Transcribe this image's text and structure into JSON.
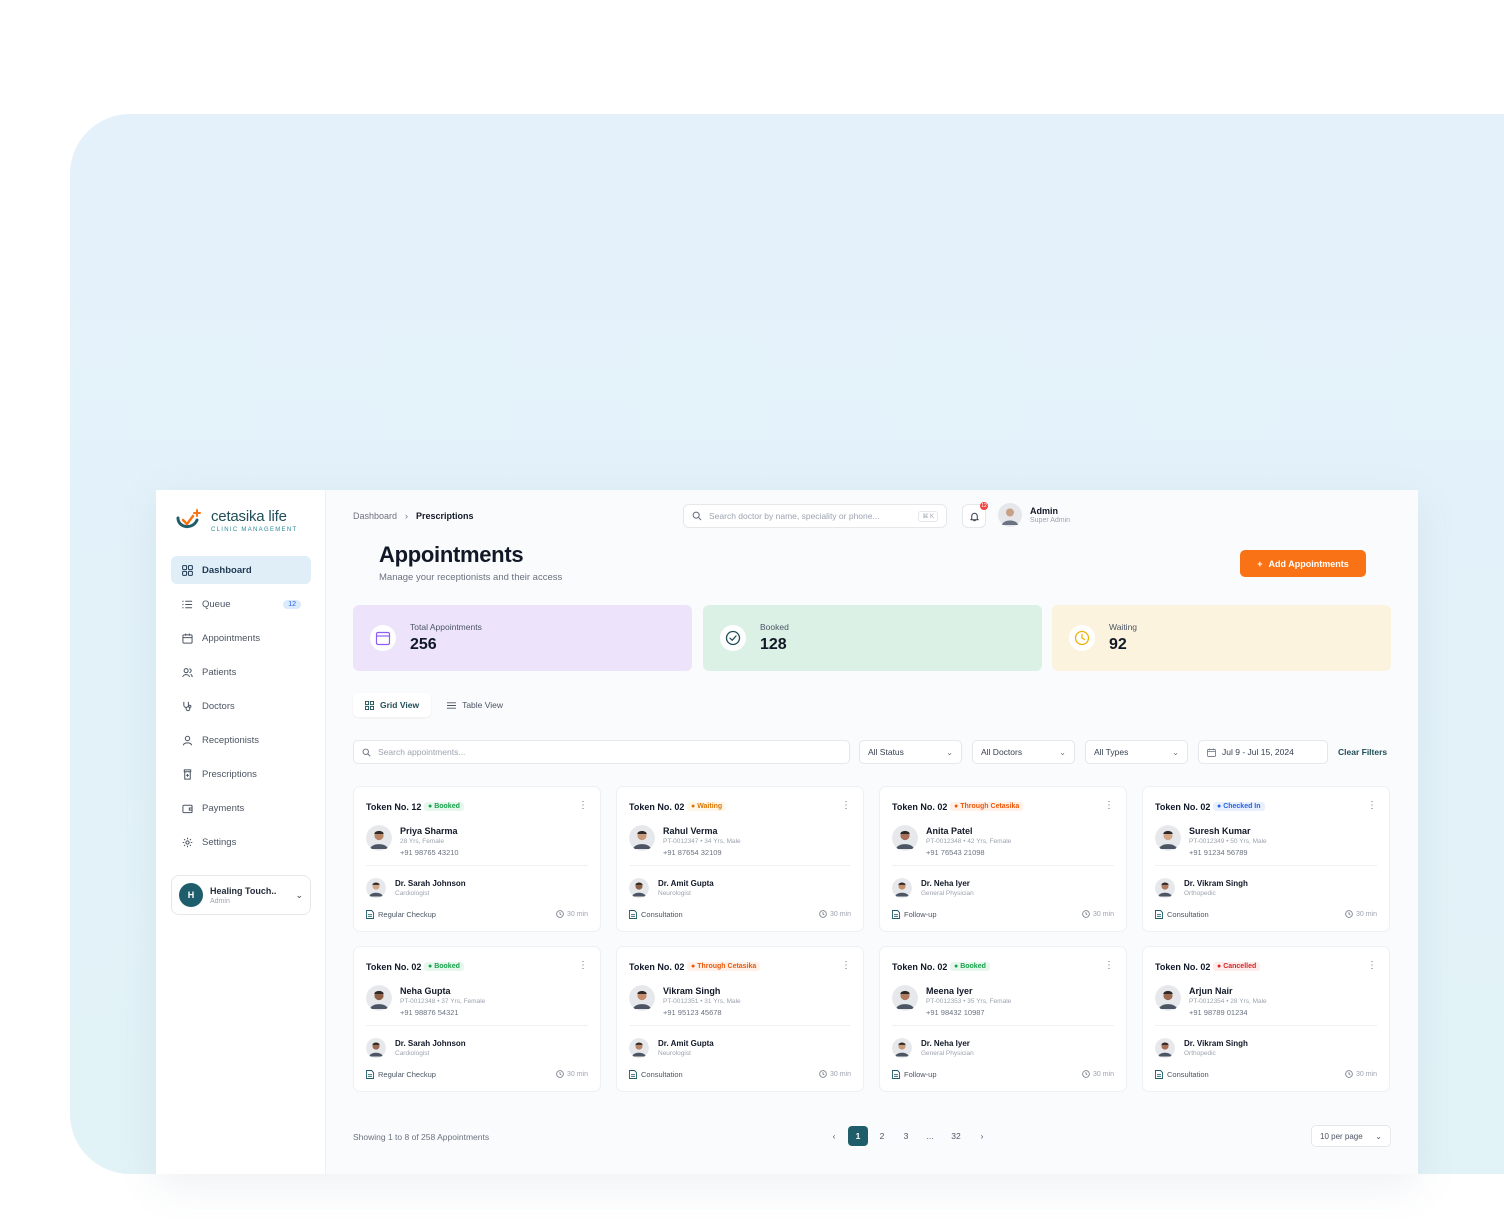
{
  "brand": {
    "name": "cetasika life",
    "tagline": "CLINIC MANAGEMENT"
  },
  "sidebar": {
    "items": [
      {
        "label": "Dashboard",
        "icon": "grid-icon",
        "active": true
      },
      {
        "label": "Queue",
        "icon": "list-icon",
        "badge": "12"
      },
      {
        "label": "Appointments",
        "icon": "calendar-icon"
      },
      {
        "label": "Patients",
        "icon": "users-icon"
      },
      {
        "label": "Doctors",
        "icon": "stethoscope-icon"
      },
      {
        "label": "Receptionists",
        "icon": "user-icon"
      },
      {
        "label": "Prescriptions",
        "icon": "prescription-icon"
      },
      {
        "label": "Payments",
        "icon": "wallet-icon"
      },
      {
        "label": "Settings",
        "icon": "gear-icon"
      }
    ],
    "clinic": {
      "initial": "H",
      "name": "Healing Touch..",
      "role": "Admin"
    }
  },
  "header": {
    "breadcrumb": [
      "Dashboard",
      "Prescriptions"
    ],
    "search_placeholder": "Search doctor by name, speciality or phone...",
    "shortcut": "⌘ K",
    "notification_count": "12",
    "user": {
      "name": "Admin",
      "role": "Super Admin"
    }
  },
  "page": {
    "title": "Appointments",
    "subtitle": "Manage your receptionists and their access",
    "add_button": "Add Appointments"
  },
  "stats": [
    {
      "label": "Total Appointments",
      "value": "256",
      "color": "#ede4fb",
      "icon": "calendar-icon"
    },
    {
      "label": "Booked",
      "value": "128",
      "color": "#dcf1e6",
      "icon": "check-circle-icon"
    },
    {
      "label": "Waiting",
      "value": "92",
      "color": "#fcf3de",
      "icon": "clock-icon"
    }
  ],
  "views": {
    "grid": "Grid View",
    "table": "Table View"
  },
  "filters": {
    "search_placeholder": "Search appointments...",
    "status": "All Status",
    "doctors": "All Doctors",
    "types": "All Types",
    "date_range": "Jul 9 - Jul 15, 2024",
    "clear": "Clear Filters"
  },
  "cards": [
    {
      "token": "Token No. 12",
      "status": "Booked",
      "status_color": "#16a34a",
      "status_bg": "#e8f7ee",
      "patient": "Priya Sharma",
      "meta": "28 Yrs, Female",
      "phone": "+91 98765 43210",
      "doctor": "Dr. Sarah Johnson",
      "spec": "Cardiologist",
      "type": "Regular Checkup",
      "duration": "30 min"
    },
    {
      "token": "Token No. 02",
      "status": "Waiting",
      "status_color": "#d97706",
      "status_bg": "#fef6e6",
      "patient": "Rahul Verma",
      "meta": "PT-0012347 • 34 Yrs, Male",
      "phone": "+91 87654 32109",
      "doctor": "Dr. Amit Gupta",
      "spec": "Neurologist",
      "type": "Consultation",
      "duration": "30 min"
    },
    {
      "token": "Token No. 02",
      "status": "Through Cetasika",
      "status_color": "#ea580c",
      "status_bg": "#fff1e7",
      "patient": "Anita Patel",
      "meta": "PT-0012348 • 42 Yrs, Female",
      "phone": "+91 76543 21098",
      "doctor": "Dr. Neha Iyer",
      "spec": "General Physician",
      "type": "Follow-up",
      "duration": "30 min"
    },
    {
      "token": "Token No. 02",
      "status": "Checked In",
      "status_color": "#2563eb",
      "status_bg": "#e8f0fd",
      "patient": "Suresh Kumar",
      "meta": "PT-0012349 • 50 Yrs, Male",
      "phone": "+91 91234 56789",
      "doctor": "Dr. Vikram Singh",
      "spec": "Orthopedic",
      "type": "Consultation",
      "duration": "30 min"
    },
    {
      "token": "Token No. 02",
      "status": "Booked",
      "status_color": "#16a34a",
      "status_bg": "#e8f7ee",
      "patient": "Neha Gupta",
      "meta": "PT-0012348 • 37 Yrs, Female",
      "phone": "+91 98876 54321",
      "doctor": "Dr. Sarah Johnson",
      "spec": "Cardiologist",
      "type": "Regular Checkup",
      "duration": "30 min"
    },
    {
      "token": "Token No. 02",
      "status": "Through Cetasika",
      "status_color": "#ea580c",
      "status_bg": "#fff1e7",
      "patient": "Vikram Singh",
      "meta": "PT-0012351 • 31 Yrs, Male",
      "phone": "+91 95123 45678",
      "doctor": "Dr. Amit Gupta",
      "spec": "Neurologist",
      "type": "Consultation",
      "duration": "30 min"
    },
    {
      "token": "Token No. 02",
      "status": "Booked",
      "status_color": "#16a34a",
      "status_bg": "#e8f7ee",
      "patient": "Meena Iyer",
      "meta": "PT-0012353 • 35 Yrs, Female",
      "phone": "+91 98432 10987",
      "doctor": "Dr. Neha Iyer",
      "spec": "General Physician",
      "type": "Follow-up",
      "duration": "30 min"
    },
    {
      "token": "Token No. 02",
      "status": "Cancelled",
      "status_color": "#dc2626",
      "status_bg": "#fdecec",
      "patient": "Arjun Nair",
      "meta": "PT-0012354 • 28 Yrs, Male",
      "phone": "+91 98789 01234",
      "doctor": "Dr. Vikram Singh",
      "spec": "Orthopedic",
      "type": "Consultation",
      "duration": "30 min"
    }
  ],
  "footer": {
    "showing": "Showing 1 to 8 of 258 Appointments",
    "pages": [
      "1",
      "2",
      "3",
      "...",
      "32"
    ],
    "current_page": "1",
    "per_page": "10 per page"
  }
}
